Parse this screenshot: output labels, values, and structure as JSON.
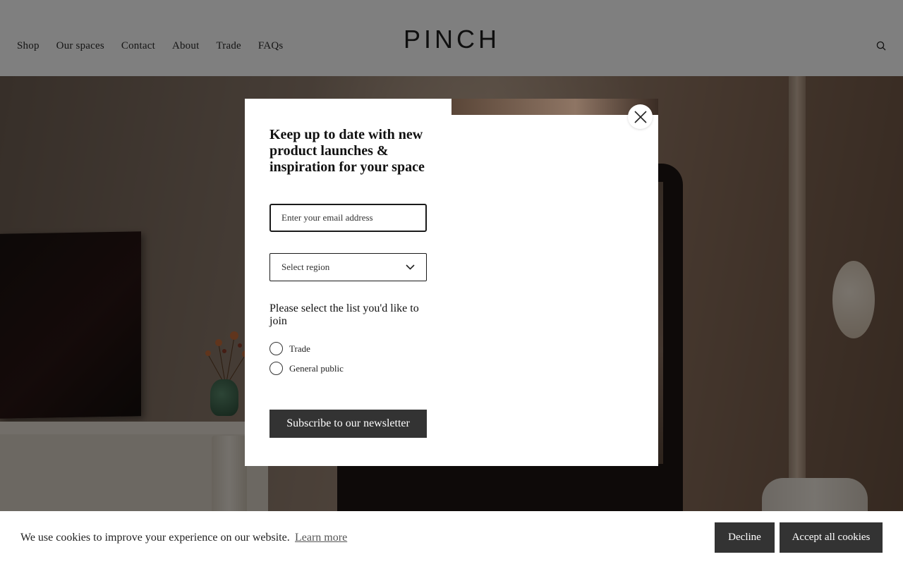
{
  "header": {
    "nav": [
      "Shop",
      "Our spaces",
      "Contact",
      "About",
      "Trade",
      "FAQs"
    ],
    "logo": "PINCH",
    "search_icon": "search-icon"
  },
  "modal": {
    "title": "Keep up to date with new product launches & inspiration for your space",
    "email_placeholder": "Enter your email address",
    "email_value": "",
    "region_placeholder": "Select region",
    "list_label": "Please select the list you'd like to join",
    "options": [
      "Trade",
      "General public"
    ],
    "subscribe_label": "Subscribe to our newsletter",
    "close_icon": "close-icon"
  },
  "cookie": {
    "text": "We use cookies to improve your experience on our website.",
    "learn_more": "Learn more",
    "decline": "Decline",
    "accept": "Accept all cookies"
  },
  "colors": {
    "button_bg": "#333333",
    "overlay": "rgba(0,0,0,0.5)"
  }
}
